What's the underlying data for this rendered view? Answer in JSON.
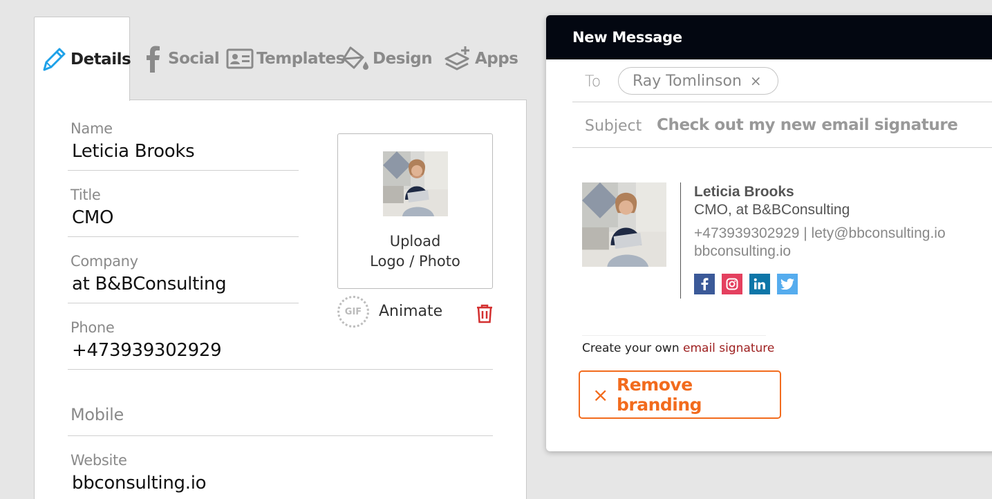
{
  "tabs": [
    {
      "label": "Details",
      "icon": "pen-icon",
      "active": true
    },
    {
      "label": "Social",
      "icon": "facebook-icon"
    },
    {
      "label": "Templates",
      "icon": "id-card-icon"
    },
    {
      "label": "Design",
      "icon": "paint-bucket-icon"
    },
    {
      "label": "Apps",
      "icon": "layers-plus-icon"
    }
  ],
  "form": {
    "name": {
      "label": "Name",
      "value": "Leticia Brooks"
    },
    "title": {
      "label": "Title",
      "value": "CMO"
    },
    "company": {
      "label": "Company",
      "value": "at B&BConsulting"
    },
    "phone": {
      "label": "Phone",
      "value": "+473939302929"
    },
    "mobile": {
      "placeholder": "Mobile"
    },
    "website": {
      "label": "Website",
      "value": "bbconsulting.io"
    }
  },
  "upload": {
    "line1": "Upload",
    "line2": "Logo / Photo"
  },
  "animate": {
    "badge": "GIF",
    "label": "Animate"
  },
  "compose": {
    "header": "New Message",
    "to_label": "To",
    "recipient": "Ray Tomlinson",
    "recipient_remove": "×",
    "subject_label": "Subject",
    "subject": "Check out my new email signature"
  },
  "signature": {
    "name": "Leticia Brooks",
    "title_line": "CMO, at B&BConsulting",
    "contact_line": "+473939302929 | lety@bbconsulting.io",
    "website": "bbconsulting.io",
    "socials": [
      {
        "name": "facebook",
        "glyph": "f",
        "color": "#3b5998"
      },
      {
        "name": "instagram",
        "glyph": "◎",
        "color": "#e4405f"
      },
      {
        "name": "linkedin",
        "glyph": "in",
        "color": "#0e76a8"
      },
      {
        "name": "twitter",
        "glyph": "🐦",
        "color": "#55acee"
      }
    ]
  },
  "promo": {
    "text": "Create your own ",
    "link": "email signature"
  },
  "remove_branding": {
    "icon": "×",
    "label": "Remove branding"
  },
  "colors": {
    "accent_blue": "#1da1e8",
    "brand_orange": "#f26b1d",
    "link_red": "#9d1e1e",
    "trash_red": "#d32f2f"
  }
}
